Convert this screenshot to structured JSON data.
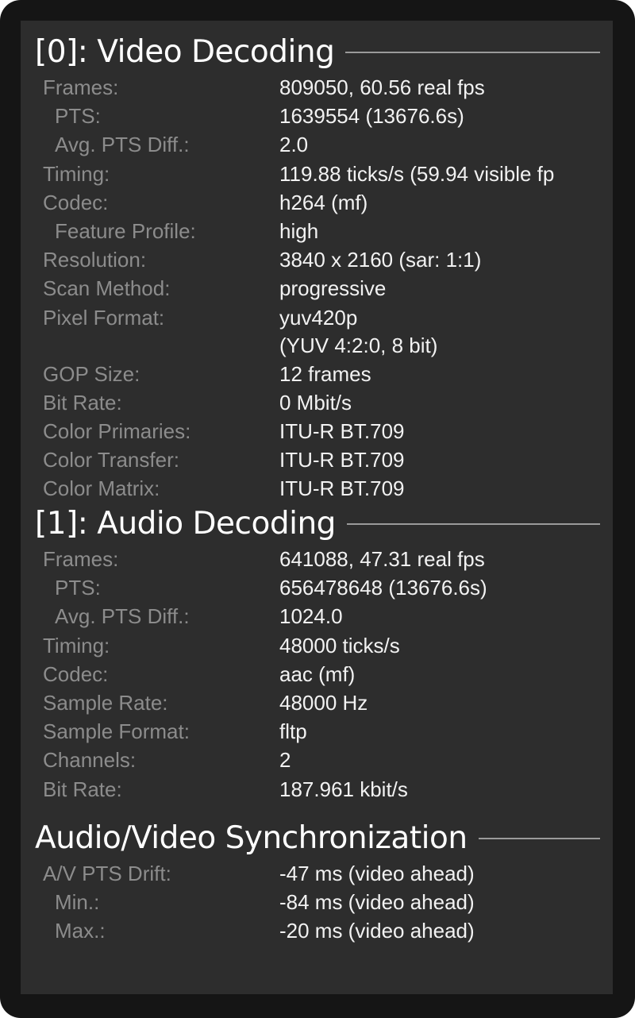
{
  "video": {
    "title": "[0]: Video Decoding",
    "rows": [
      {
        "label": "Frames:",
        "value": "809050, 60.56 real fps"
      },
      {
        "label": "PTS:",
        "value": "1639554 (13676.6s)"
      },
      {
        "label": "Avg. PTS Diff.:",
        "value": "2.0"
      },
      {
        "label": "Timing:",
        "value": "119.88 ticks/s (59.94 visible fp"
      },
      {
        "label": "Codec:",
        "value": "h264 (mf)"
      },
      {
        "label": "Feature Profile:",
        "value": "high"
      },
      {
        "label": "Resolution:",
        "value": "3840 x 2160 (sar: 1:1)"
      },
      {
        "label": "Scan Method:",
        "value": "progressive"
      },
      {
        "label": "Pixel Format:",
        "value": "yuv420p"
      },
      {
        "label": "",
        "value": "(YUV 4:2:0, 8 bit)"
      },
      {
        "label": "GOP Size:",
        "value": "12 frames"
      },
      {
        "label": "Bit Rate:",
        "value": "0 Mbit/s"
      },
      {
        "label": "Color Primaries:",
        "value": "ITU-R BT.709"
      },
      {
        "label": "Color Transfer:",
        "value": "ITU-R BT.709"
      },
      {
        "label": "Color Matrix:",
        "value": "ITU-R BT.709"
      }
    ]
  },
  "audio": {
    "title": "[1]: Audio Decoding",
    "rows": [
      {
        "label": "Frames:",
        "value": "641088, 47.31 real fps"
      },
      {
        "label": "PTS:",
        "value": "656478648 (13676.6s)"
      },
      {
        "label": "Avg. PTS Diff.:",
        "value": "1024.0"
      },
      {
        "label": "Timing:",
        "value": "48000 ticks/s"
      },
      {
        "label": "Codec:",
        "value": "aac (mf)"
      },
      {
        "label": "Sample Rate:",
        "value": "48000 Hz"
      },
      {
        "label": "Sample Format:",
        "value": "fltp"
      },
      {
        "label": "Channels:",
        "value": "2"
      },
      {
        "label": "Bit Rate:",
        "value": "187.961 kbit/s"
      }
    ]
  },
  "sync": {
    "title": "Audio/Video Synchronization",
    "rows": [
      {
        "label": "A/V PTS Drift:",
        "value": "-47 ms (video ahead)"
      },
      {
        "label": "Min.:",
        "value": "-84 ms (video ahead)"
      },
      {
        "label": "Max.:",
        "value": "-20 ms (video ahead)"
      }
    ]
  },
  "colors": {
    "background": "#2d2d2d",
    "frame": "#151515",
    "label": "#8c8c8c",
    "value": "#f2f2f2",
    "title": "#ffffff"
  }
}
